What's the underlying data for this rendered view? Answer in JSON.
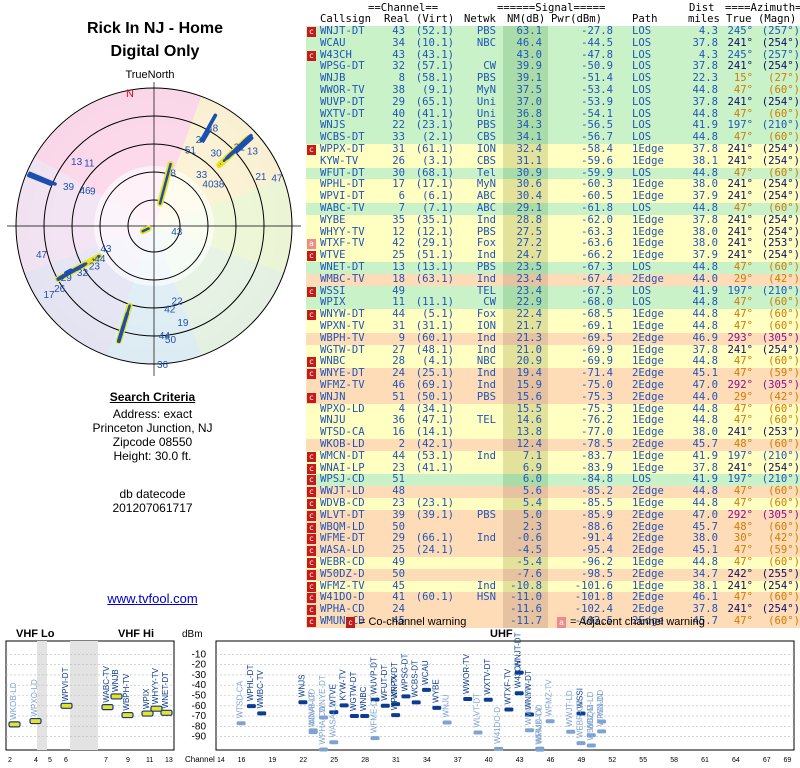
{
  "left": {
    "title1": "Rick In NJ - Home",
    "title2": "Digital Only",
    "true_north": "TrueNorth",
    "compass_n": "N",
    "criteria_heading": "Search Criteria",
    "address": "Address: exact",
    "city": "Princeton Junction, NJ",
    "zip": "Zipcode 08550",
    "height": "Height: 30.0 ft.",
    "db_label": "db datecode",
    "db_value": "201207061717",
    "site": "www.tvfool.com"
  },
  "radar_labels": [
    {
      "t": "13",
      "az": 307,
      "r": 0.78
    },
    {
      "t": "11",
      "az": 311,
      "r": 0.7
    },
    {
      "t": "48",
      "az": 27,
      "r": 0.8
    },
    {
      "t": "27",
      "az": 24,
      "r": 0.69
    },
    {
      "t": "51",
      "az": 20,
      "r": 0.59
    },
    {
      "t": "8",
      "az": 14,
      "r": 0.4
    },
    {
      "t": "31",
      "az": 44,
      "r": 0.8
    },
    {
      "t": "13",
      "az": 50,
      "r": 0.85
    },
    {
      "t": "30",
      "az": 36,
      "r": 0.66
    },
    {
      "t": "33",
      "az": 37,
      "r": 0.47
    },
    {
      "t": "40",
      "az": 47,
      "r": 0.45
    },
    {
      "t": "38",
      "az": 53,
      "r": 0.51
    },
    {
      "t": "21",
      "az": 63,
      "r": 0.8
    },
    {
      "t": "47",
      "az": 67,
      "r": 0.9
    },
    {
      "t": "39",
      "az": 293,
      "r": 0.74
    },
    {
      "t": "46",
      "az": 295,
      "r": 0.62
    },
    {
      "t": "9",
      "az": 298,
      "r": 0.55
    },
    {
      "t": "47",
      "az": 257,
      "r": 0.9
    },
    {
      "t": "43",
      "az": 249,
      "r": 0.44
    },
    {
      "t": "44",
      "az": 243,
      "r": 0.51
    },
    {
      "t": "23",
      "az": 240,
      "r": 0.57
    },
    {
      "t": "32",
      "az": 240,
      "r": 0.67
    },
    {
      "t": "29",
      "az": 242,
      "r": 0.79
    },
    {
      "t": "26",
      "az": 239,
      "r": 0.87
    },
    {
      "t": "17",
      "az": 239,
      "r": 0.96
    },
    {
      "t": "43",
      "az": 110,
      "r": 0.11
    },
    {
      "t": "22",
      "az": 169,
      "r": 0.55
    },
    {
      "t": "42",
      "az": 175,
      "r": 0.6
    },
    {
      "t": "19",
      "az": 168,
      "r": 0.71
    },
    {
      "t": "44",
      "az": 179,
      "r": 0.79
    },
    {
      "t": "50",
      "az": 176,
      "r": 0.82
    },
    {
      "t": "36",
      "az": 180,
      "r": 1.0
    }
  ],
  "header": {
    "groups": [
      "==Channel==",
      "======Signal=====",
      "Dist",
      "====Azimuth==="
    ],
    "cols": [
      "Callsign",
      "Real",
      "(Virt)",
      "Netwk",
      "NM(dB)",
      "Pwr(dBm)",
      "Path",
      "miles",
      "True",
      "(Magn)"
    ]
  },
  "rows": [
    [
      "c",
      "WNJT-DT",
      "43",
      "(52.1)",
      "PBS",
      "63.1",
      "-27.8",
      "LOS",
      "4.3",
      "245°",
      "(257°)"
    ],
    [
      "",
      "WCAU",
      "34",
      "(10.1)",
      "NBC",
      "46.4",
      "-44.5",
      "LOS",
      "37.8",
      "241°",
      "(254°)"
    ],
    [
      "c",
      "W43CH",
      "43",
      "(43.1)",
      "",
      "43.0",
      "-47.8",
      "LOS",
      "4.3",
      "245°",
      "(257°)"
    ],
    [
      "",
      "WPSG-DT",
      "32",
      "(57.1)",
      "CW",
      "39.9",
      "-50.9",
      "LOS",
      "37.8",
      "241°",
      "(254°)"
    ],
    [
      "",
      "WNJB",
      "8",
      "(58.1)",
      "PBS",
      "39.1",
      "-51.4",
      "LOS",
      "22.3",
      "15°",
      "(27°)"
    ],
    [
      "",
      "WWOR-TV",
      "38",
      "(9.1)",
      "MyN",
      "37.5",
      "-53.4",
      "LOS",
      "44.8",
      "47°",
      "(60°)"
    ],
    [
      "",
      "WUVP-DT",
      "29",
      "(65.1)",
      "Uni",
      "37.0",
      "-53.9",
      "LOS",
      "37.8",
      "241°",
      "(254°)"
    ],
    [
      "",
      "WXTV-DT",
      "40",
      "(41.1)",
      "Uni",
      "36.8",
      "-54.1",
      "LOS",
      "44.8",
      "47°",
      "(60°)"
    ],
    [
      "",
      "WNJS",
      "22",
      "(23.1)",
      "PBS",
      "34.3",
      "-56.5",
      "LOS",
      "41.9",
      "197°",
      "(210°)"
    ],
    [
      "",
      "WCBS-DT",
      "33",
      "(2.1)",
      "CBS",
      "34.1",
      "-56.7",
      "LOS",
      "44.8",
      "47°",
      "(60°)"
    ],
    [
      "c",
      "WPPX-DT",
      "31",
      "(61.1)",
      "ION",
      "32.4",
      "-58.4",
      "1Edge",
      "37.8",
      "241°",
      "(254°)"
    ],
    [
      "",
      "KYW-TV",
      "26",
      "(3.1)",
      "CBS",
      "31.1",
      "-59.6",
      "1Edge",
      "38.1",
      "241°",
      "(254°)"
    ],
    [
      "",
      "WFUT-DT",
      "30",
      "(68.1)",
      "Tel",
      "30.9",
      "-59.9",
      "LOS",
      "44.8",
      "47°",
      "(60°)"
    ],
    [
      "",
      "WPHL-DT",
      "17",
      "(17.1)",
      "MyN",
      "30.6",
      "-60.3",
      "1Edge",
      "38.0",
      "241°",
      "(254°)"
    ],
    [
      "",
      "WPVI-DT",
      "6",
      "(6.1)",
      "ABC",
      "30.4",
      "-60.5",
      "1Edge",
      "37.9",
      "241°",
      "(254°)"
    ],
    [
      "",
      "WABC-TV",
      "7",
      "(7.1)",
      "ABC",
      "29.1",
      "-61.8",
      "LOS",
      "44.8",
      "47°",
      "(60°)"
    ],
    [
      "",
      "WYBE",
      "35",
      "(35.1)",
      "Ind",
      "28.8",
      "-62.0",
      "1Edge",
      "37.8",
      "241°",
      "(254°)"
    ],
    [
      "",
      "WHYY-TV",
      "12",
      "(12.1)",
      "PBS",
      "27.5",
      "-63.3",
      "1Edge",
      "38.0",
      "241°",
      "(254°)"
    ],
    [
      "a",
      "WTXF-TV",
      "42",
      "(29.1)",
      "Fox",
      "27.2",
      "-63.6",
      "1Edge",
      "38.0",
      "241°",
      "(253°)"
    ],
    [
      "c",
      "WTVE",
      "25",
      "(51.1)",
      "Ind",
      "24.7",
      "-66.2",
      "1Edge",
      "37.9",
      "241°",
      "(254°)"
    ],
    [
      "",
      "WNET-DT",
      "13",
      "(13.1)",
      "PBS",
      "23.5",
      "-67.3",
      "LOS",
      "44.8",
      "47°",
      "(60°)"
    ],
    [
      "",
      "WMBC-TV",
      "18",
      "(63.1)",
      "Ind",
      "23.4",
      "-67.4",
      "2Edge",
      "44.0",
      "29°",
      "(42°)"
    ],
    [
      "c",
      "WSSI",
      "49",
      "",
      "TEL",
      "23.4",
      "-67.5",
      "LOS",
      "41.9",
      "197°",
      "(210°)"
    ],
    [
      "",
      "WPIX",
      "11",
      "(11.1)",
      "CW",
      "22.9",
      "-68.0",
      "LOS",
      "44.8",
      "47°",
      "(60°)"
    ],
    [
      "c",
      "WNYW-DT",
      "44",
      "(5.1)",
      "Fox",
      "22.4",
      "-68.5",
      "1Edge",
      "44.8",
      "47°",
      "(60°)"
    ],
    [
      "",
      "WPXN-TV",
      "31",
      "(31.1)",
      "ION",
      "21.7",
      "-69.1",
      "1Edge",
      "44.8",
      "47°",
      "(60°)"
    ],
    [
      "",
      "WBPH-TV",
      "9",
      "(60.1)",
      "Ind",
      "21.3",
      "-69.5",
      "2Edge",
      "46.9",
      "293°",
      "(305°)"
    ],
    [
      "",
      "WGTW-DT",
      "27",
      "(48.1)",
      "Ind",
      "21.0",
      "-69.9",
      "1Edge",
      "37.8",
      "241°",
      "(254°)"
    ],
    [
      "c",
      "WNBC",
      "28",
      "(4.1)",
      "NBC",
      "20.9",
      "-69.9",
      "1Edge",
      "44.8",
      "47°",
      "(60°)"
    ],
    [
      "c",
      "WNYE-DT",
      "24",
      "(25.1)",
      "Ind",
      "19.4",
      "-71.4",
      "2Edge",
      "45.1",
      "47°",
      "(59°)"
    ],
    [
      "",
      "WFMZ-TV",
      "46",
      "(69.1)",
      "Ind",
      "15.9",
      "-75.0",
      "2Edge",
      "47.0",
      "292°",
      "(305°)"
    ],
    [
      "c",
      "WNJN",
      "51",
      "(50.1)",
      "PBS",
      "15.6",
      "-75.3",
      "2Edge",
      "44.0",
      "29°",
      "(42°)"
    ],
    [
      "",
      "WPXO-LD",
      "4",
      "(34.1)",
      "",
      "15.5",
      "-75.3",
      "1Edge",
      "44.8",
      "47°",
      "(60°)"
    ],
    [
      "",
      "WNJU",
      "36",
      "(47.1)",
      "TEL",
      "14.6",
      "-76.2",
      "1Edge",
      "44.8",
      "47°",
      "(60°)"
    ],
    [
      "",
      "WTSD-CA",
      "16",
      "(14.1)",
      "",
      "13.8",
      "-77.0",
      "1Edge",
      "38.0",
      "241°",
      "(253°)"
    ],
    [
      "",
      "WKOB-LD",
      "2",
      "(42.1)",
      "",
      "12.4",
      "-78.5",
      "2Edge",
      "45.7",
      "48°",
      "(60°)"
    ],
    [
      "ca",
      "WMCN-DT",
      "44",
      "(53.1)",
      "Ind",
      "7.1",
      "-83.7",
      "1Edge",
      "41.9",
      "197°",
      "(210°)"
    ],
    [
      "ca",
      "WNAI-LP",
      "23",
      "(41.1)",
      "",
      "6.9",
      "-83.9",
      "1Edge",
      "37.8",
      "241°",
      "(254°)"
    ],
    [
      "c",
      "WPSJ-CD",
      "51",
      "",
      "",
      "6.0",
      "-84.8",
      "LOS",
      "41.9",
      "197°",
      "(210°)"
    ],
    [
      "ca",
      "WWJT-LD",
      "48",
      "",
      "",
      "5.6",
      "-85.2",
      "2Edge",
      "44.8",
      "47°",
      "(60°)"
    ],
    [
      "ca",
      "WDVB-CD",
      "23",
      "(23.1)",
      "",
      "5.4",
      "-85.5",
      "1Edge",
      "44.8",
      "47°",
      "(60°)"
    ],
    [
      "ca",
      "WLVT-DT",
      "39",
      "(39.1)",
      "PBS",
      "5.0",
      "-85.9",
      "2Edge",
      "47.0",
      "292°",
      "(305°)"
    ],
    [
      "c",
      "WBQM-LD",
      "50",
      "",
      "",
      "2.3",
      "-88.6",
      "2Edge",
      "45.7",
      "48°",
      "(60°)"
    ],
    [
      "ca",
      "WFME-DT",
      "29",
      "(66.1)",
      "Ind",
      "-0.6",
      "-91.4",
      "2Edge",
      "38.0",
      "30°",
      "(42°)"
    ],
    [
      "c",
      "WASA-LD",
      "25",
      "(24.1)",
      "",
      "-4.5",
      "-95.4",
      "2Edge",
      "45.1",
      "47°",
      "(59°)"
    ],
    [
      "c",
      "WEBR-CD",
      "49",
      "",
      "",
      "-5.4",
      "-96.2",
      "1Edge",
      "44.8",
      "47°",
      "(60°)"
    ],
    [
      "c",
      "W50DZ-D",
      "50",
      "",
      "",
      "-7.6",
      "-98.5",
      "2Edge",
      "34.7",
      "242°",
      "(255°)"
    ],
    [
      "c",
      "WFMZ-TV",
      "45",
      "",
      "Ind",
      "-10.8",
      "-101.6",
      "1Edge",
      "38.1",
      "241°",
      "(254°)"
    ],
    [
      "ca",
      "W41DO-D",
      "41",
      "(60.1)",
      "HSN",
      "-11.0",
      "-101.8",
      "2Edge",
      "46.1",
      "47°",
      "(60°)"
    ],
    [
      "c",
      "WPHA-CD",
      "24",
      "",
      "",
      "-11.6",
      "-102.4",
      "2Edge",
      "37.8",
      "241°",
      "(254°)"
    ],
    [
      "c",
      "WMUN-CD",
      "45",
      "",
      "",
      "-11.7",
      "-102.5",
      "2Edge",
      "45.7",
      "47°",
      "(60°)"
    ]
  ],
  "legend": {
    "co": "= Co-channel warning",
    "adj": "= Adjacent channel warning",
    "co_glyph": "c",
    "adj_glyph": "a"
  },
  "spectrum": {
    "vhf_lo": "VHF Lo",
    "vhf_hi": "VHF Hi",
    "uhf": "UHF",
    "dbm": "dBm",
    "channel_label": "Channel",
    "yticks": [
      "-10",
      "-20",
      "-30",
      "-40",
      "-50",
      "-60",
      "-70",
      "-80",
      "-90"
    ],
    "vhf_lo_ticks": [
      "2",
      "4",
      "5",
      "6"
    ],
    "vhf_hi_ticks": [
      "7",
      "9",
      "11",
      "13"
    ],
    "uhf_ticks": [
      "14",
      "16",
      "19",
      "22",
      "25",
      "28",
      "31",
      "34",
      "37",
      "40",
      "43",
      "46",
      "49",
      "52",
      "55",
      "58",
      "61",
      "64",
      "67",
      "69"
    ]
  },
  "colors": {
    "co_warn": "#c41a1a",
    "adj_warn": "#ee8a8a",
    "los": "#c9f2c9",
    "edge1": "#ffffc2",
    "edge2": "#ffdcb8",
    "tunnel": "#dcdcdc",
    "link": "#0000cc",
    "blue_text": "#2055b8",
    "orange_text": "#d27a00",
    "purple_text": "#8f0b8f",
    "navy_text": "#0c0c66"
  }
}
